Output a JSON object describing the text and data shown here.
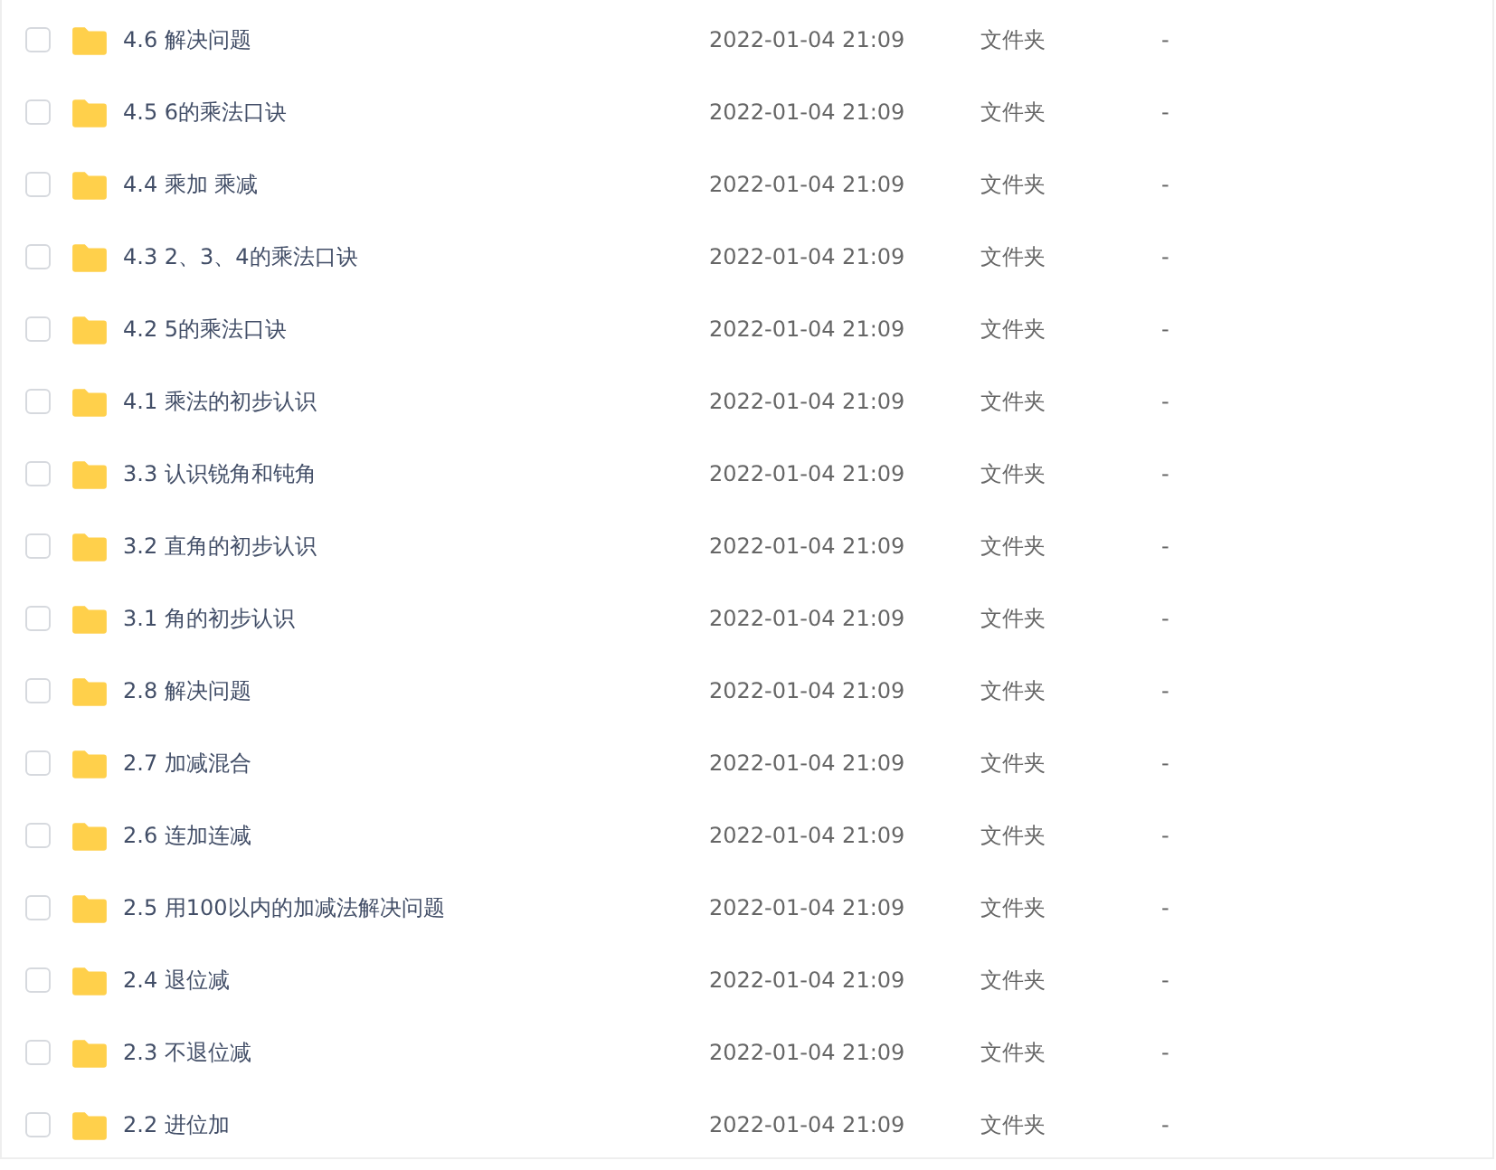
{
  "rows": [
    {
      "name": "4.6 解决问题",
      "modified": "2022-01-04 21:09",
      "type": "文件夹",
      "size": "-",
      "checked": false
    },
    {
      "name": "4.5 6的乘法口诀",
      "modified": "2022-01-04 21:09",
      "type": "文件夹",
      "size": "-",
      "checked": false
    },
    {
      "name": "4.4 乘加 乘减",
      "modified": "2022-01-04 21:09",
      "type": "文件夹",
      "size": "-",
      "checked": false
    },
    {
      "name": "4.3 2、3、4的乘法口诀",
      "modified": "2022-01-04 21:09",
      "type": "文件夹",
      "size": "-",
      "checked": false
    },
    {
      "name": "4.2 5的乘法口诀",
      "modified": "2022-01-04 21:09",
      "type": "文件夹",
      "size": "-",
      "checked": false
    },
    {
      "name": "4.1 乘法的初步认识",
      "modified": "2022-01-04 21:09",
      "type": "文件夹",
      "size": "-",
      "checked": false
    },
    {
      "name": "3.3 认识锐角和钝角",
      "modified": "2022-01-04 21:09",
      "type": "文件夹",
      "size": "-",
      "checked": false
    },
    {
      "name": "3.2 直角的初步认识",
      "modified": "2022-01-04 21:09",
      "type": "文件夹",
      "size": "-",
      "checked": false
    },
    {
      "name": "3.1 角的初步认识",
      "modified": "2022-01-04 21:09",
      "type": "文件夹",
      "size": "-",
      "checked": false
    },
    {
      "name": "2.8 解决问题",
      "modified": "2022-01-04 21:09",
      "type": "文件夹",
      "size": "-",
      "checked": false
    },
    {
      "name": "2.7 加减混合",
      "modified": "2022-01-04 21:09",
      "type": "文件夹",
      "size": "-",
      "checked": false
    },
    {
      "name": "2.6 连加连减",
      "modified": "2022-01-04 21:09",
      "type": "文件夹",
      "size": "-",
      "checked": false
    },
    {
      "name": "2.5 用100以内的加减法解决问题",
      "modified": "2022-01-04 21:09",
      "type": "文件夹",
      "size": "-",
      "checked": false
    },
    {
      "name": "2.4 退位减",
      "modified": "2022-01-04 21:09",
      "type": "文件夹",
      "size": "-",
      "checked": false
    },
    {
      "name": "2.3 不退位减",
      "modified": "2022-01-04 21:09",
      "type": "文件夹",
      "size": "-",
      "checked": false
    },
    {
      "name": "2.2 进位加",
      "modified": "2022-01-04 21:09",
      "type": "文件夹",
      "size": "-",
      "checked": false
    }
  ]
}
